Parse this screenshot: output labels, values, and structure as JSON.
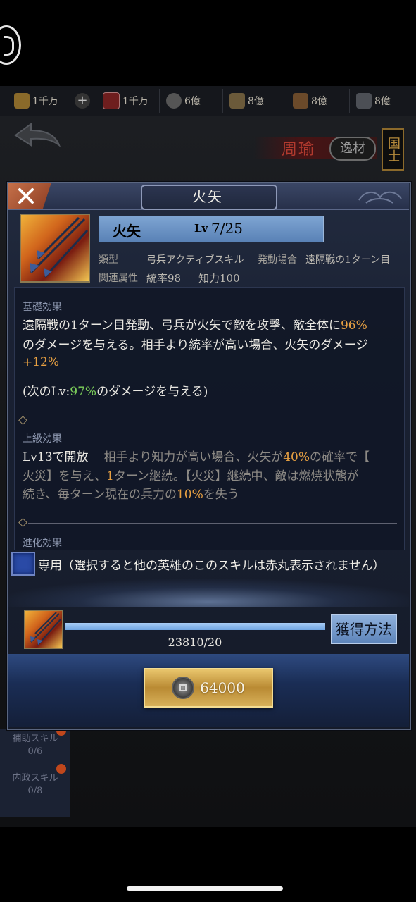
{
  "resources": [
    {
      "icon": "gold-ingot-icon",
      "value": "1千万"
    },
    {
      "icon": "plus-icon",
      "value": ""
    },
    {
      "icon": "token-icon",
      "value": "1千万"
    },
    {
      "icon": "coin-icon",
      "value": "6億"
    },
    {
      "icon": "grain-icon",
      "value": "8億"
    },
    {
      "icon": "wood-icon",
      "value": "8億"
    },
    {
      "icon": "iron-icon",
      "value": "8億"
    }
  ],
  "hero": {
    "name": "周瑜",
    "tag": "逸材",
    "rank": "国士"
  },
  "side_tabs": [
    {
      "label": "補助スキル",
      "count": "0/6"
    },
    {
      "label": "内政スキル",
      "count": "0/8"
    }
  ],
  "dialog": {
    "title": "火矢",
    "skill": {
      "name": "火矢",
      "lv_prefix": "Lv",
      "lv": "7/25"
    },
    "meta": {
      "type_label": "類型",
      "type_value": "弓兵アクティブスキル",
      "trigger_label": "発動場合",
      "trigger_value": "遠隔戦の1ターン目",
      "attr_label": "関連属性",
      "attr_1": "統率98",
      "attr_2": "知力100"
    },
    "basic": {
      "title": "基礎効果",
      "line1_a": "遠隔戦の1ターン目発動、弓兵が火矢で敵を攻撃、敵全体に",
      "line1_pct": "96%",
      "line2": "のダメージを与える。相手より統率が高い場合、火矢のダメージ",
      "line3_pct": "+12%",
      "next_a": "(次のLv:",
      "next_pct": "97%",
      "next_b": "のダメージを与える)"
    },
    "advanced": {
      "title": "上級効果",
      "unlock": "Lv13で開放",
      "line1_a": "相手より知力が高い場合、火矢が",
      "line1_pct": "40%",
      "line1_b": "の確率で【",
      "line2_a": "火災】を与え、",
      "line2_num": "1",
      "line2_b": "ターン継続。【火災】継続中、敵は燃焼状態が",
      "line3_a": "続き、毎ターン現在の兵力の",
      "line3_pct": "10%",
      "line3_b": "を失う"
    },
    "evolve": {
      "title": "進化効果"
    },
    "exclusive_text": "専用（選択すると他の英雄のこのスキルは赤丸表示されません）",
    "progress": {
      "text": "23810/20",
      "fraction": 1.0
    },
    "acquire_label": "獲得方法",
    "price": "64000"
  },
  "colors": {
    "accent_orange": "#e7a042",
    "accent_green": "#7ed25b",
    "name_bar_blue": "#6f95c8"
  }
}
